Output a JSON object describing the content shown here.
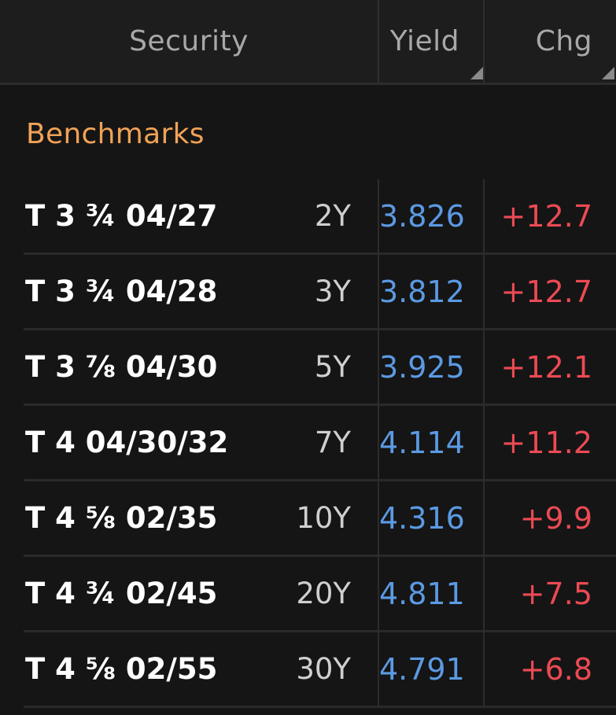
{
  "colors": {
    "background": "#151515",
    "header_background": "#1d1d1d",
    "header_text": "#a8a8a8",
    "section_accent": "#f0a257",
    "yield_color": "#5b9ae3",
    "change_positive": "#ec4a54",
    "security_text": "#ffffff"
  },
  "header": {
    "security": "Security",
    "yield": "Yield",
    "chg": "Chg"
  },
  "section": {
    "title": "Benchmarks"
  },
  "rows": [
    {
      "security": "T 3 ¾ 04/27",
      "tenor": "2Y",
      "yield": "3.826",
      "chg": "+12.7"
    },
    {
      "security": "T 3 ¾ 04/28",
      "tenor": "3Y",
      "yield": "3.812",
      "chg": "+12.7"
    },
    {
      "security": "T 3 ⅞ 04/30",
      "tenor": "5Y",
      "yield": "3.925",
      "chg": "+12.1"
    },
    {
      "security": "T 4 04/30/32",
      "tenor": "7Y",
      "yield": "4.114",
      "chg": "+11.2"
    },
    {
      "security": "T 4 ⅝ 02/35",
      "tenor": "10Y",
      "yield": "4.316",
      "chg": "+9.9"
    },
    {
      "security": "T 4 ¾ 02/45",
      "tenor": "20Y",
      "yield": "4.811",
      "chg": "+7.5"
    },
    {
      "security": "T 4 ⅝ 02/55",
      "tenor": "30Y",
      "yield": "4.791",
      "chg": "+6.8"
    }
  ]
}
